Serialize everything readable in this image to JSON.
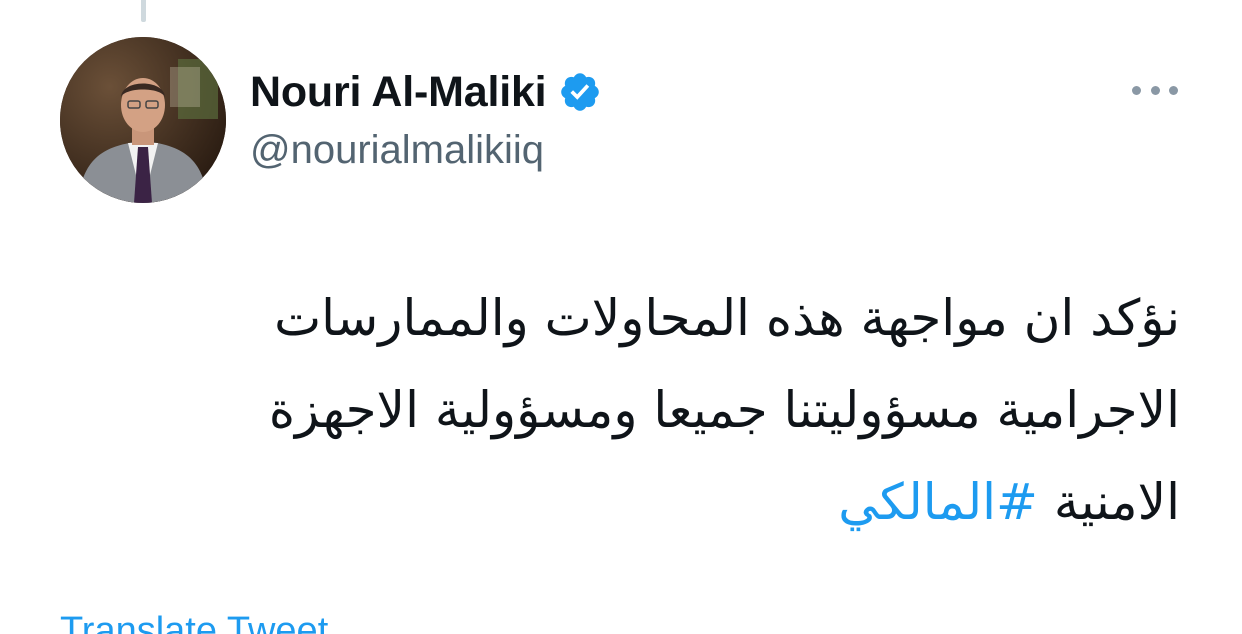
{
  "tweet": {
    "author": {
      "display_name": "Nouri Al-Maliki",
      "handle": "@nourialmalikiiq",
      "verified": true,
      "avatar_icon": "avatar"
    },
    "text_line1": "نؤكد ان مواجهة هذه المحاولات والممارسات",
    "text_line2": "الاجرامية مسؤوليتنا جميعا ومسؤولية الاجهزة",
    "text_line3": "الامنية",
    "hashtag": "#المالكي",
    "translate_label": "Translate Tweet",
    "more_icon": "more-horizontal-icon"
  },
  "colors": {
    "accent": "#1d9bf0",
    "text": "#0f1419",
    "secondary": "#536471"
  }
}
